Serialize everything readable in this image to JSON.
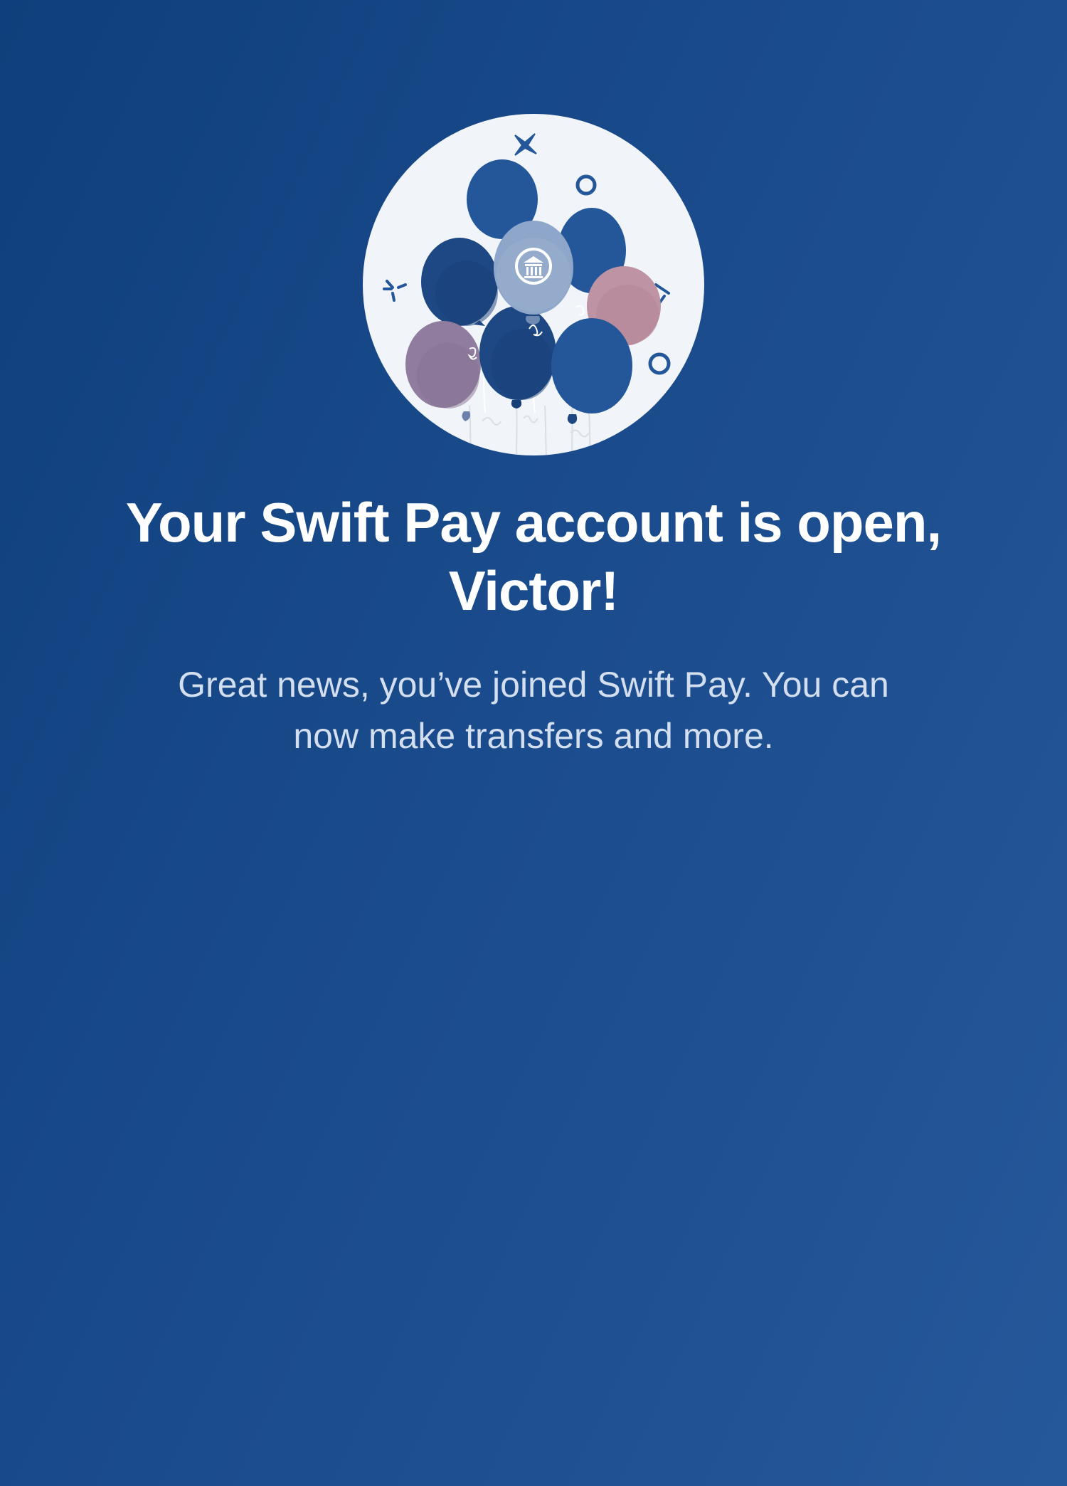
{
  "screen": {
    "title": "Your Swift Pay account is open, Victor!",
    "message": "Great news, you’ve joined Swift Pay. You can now make transfers and more."
  },
  "illustration": {
    "name": "celebration-balloons-illustration",
    "bank_icon": "bank-icon",
    "colors": {
      "circle_background": "#f1f4f9",
      "balloon_blue": "#24579a",
      "balloon_dark_blue": "#1d4883",
      "balloon_light_blue": "#8ea6c9",
      "balloon_pink": "#be93a3",
      "balloon_purple": "#907c9f"
    }
  },
  "theme": {
    "background_start": "#0f3f7c",
    "background_end": "#25589a",
    "title_color": "#ffffff",
    "message_color": "#d3deee"
  }
}
